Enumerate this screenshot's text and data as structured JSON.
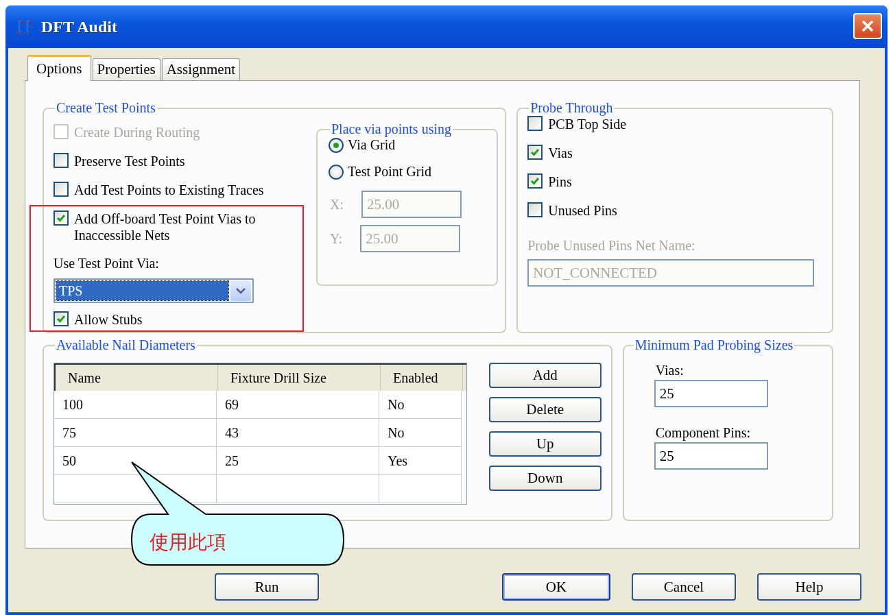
{
  "window": {
    "title": "DFT Audit"
  },
  "tabs": [
    {
      "label": "Options",
      "selected": true
    },
    {
      "label": "Properties",
      "selected": false
    },
    {
      "label": "Assignment",
      "selected": false
    }
  ],
  "create_test_points": {
    "title": "Create Test Points",
    "options": [
      {
        "label": "Create During Routing",
        "checked": false,
        "disabled": true
      },
      {
        "label": "Preserve Test Points",
        "checked": false,
        "disabled": false
      },
      {
        "label": "Add Test Points to Existing Traces",
        "checked": false,
        "disabled": false
      },
      {
        "label": "Add Off-board Test Point Vias to Inaccessible Nets",
        "checked": true,
        "disabled": false
      }
    ],
    "via_label": "Use Test Point Via:",
    "via_select": {
      "value": "TPS"
    },
    "allow_stubs": {
      "label": "Allow Stubs",
      "checked": true
    }
  },
  "place_via": {
    "title": "Place via points using",
    "options": [
      {
        "label": "Via Grid",
        "selected": true
      },
      {
        "label": "Test Point Grid",
        "selected": false
      }
    ],
    "fields": [
      {
        "label": "X:",
        "value": "25.00",
        "disabled": true
      },
      {
        "label": "Y:",
        "value": "25.00",
        "disabled": true
      }
    ]
  },
  "probe_through": {
    "title": "Probe Through",
    "options": [
      {
        "label": "PCB Top Side",
        "checked": false
      },
      {
        "label": "Vias",
        "checked": true
      },
      {
        "label": "Pins",
        "checked": true
      },
      {
        "label": "Unused Pins",
        "checked": false
      }
    ],
    "net_name": {
      "label": "Probe Unused Pins Net Name:",
      "value": "NOT_CONNECTED",
      "disabled": true
    }
  },
  "nail_diameters": {
    "title": "Available Nail Diameters",
    "columns": [
      "Name",
      "Fixture Drill Size",
      "Enabled"
    ],
    "rows": [
      [
        "100",
        "69",
        "No"
      ],
      [
        "75",
        "43",
        "No"
      ],
      [
        "50",
        "25",
        "Yes"
      ]
    ],
    "buttons": [
      "Add",
      "Delete",
      "Up",
      "Down"
    ]
  },
  "min_pad_sizes": {
    "title": "Minimum Pad Probing Sizes",
    "fields": [
      {
        "label": "Vias:",
        "value": "25"
      },
      {
        "label": "Component Pins:",
        "value": "25"
      }
    ]
  },
  "buttons": [
    {
      "label": "Run",
      "default": false
    },
    {
      "label": "OK",
      "default": true
    },
    {
      "label": "Cancel",
      "default": false
    },
    {
      "label": "Help",
      "default": false
    }
  ],
  "callout": {
    "text": "使用此項"
  }
}
